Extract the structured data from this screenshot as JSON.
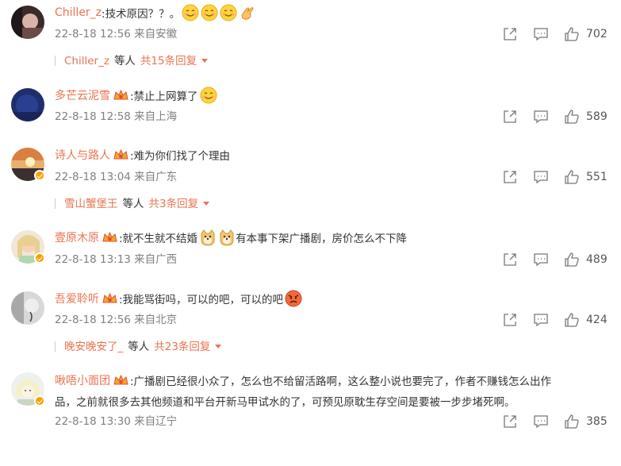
{
  "comments": [
    {
      "username": "Chiller_z",
      "text": ":技术原因？？。",
      "time": "22-8-18 12:56 来自安徽",
      "likes": "702",
      "emoji_icons": [
        "smile-emoji-icon",
        "smile-emoji-icon",
        "smile-emoji-icon",
        "clap-hand-icon"
      ],
      "replies": {
        "name": "Chiller_z",
        "etc": "等人",
        "count": "共15条回复"
      }
    },
    {
      "username": "多芒云泥雪",
      "text": ":禁止上网算了",
      "time": "22-8-18 12:58 来自上海",
      "likes": "589",
      "emoji_icons": [
        "smile-emoji-icon"
      ]
    },
    {
      "username": "诗人与路人",
      "text": ":难为你们找了个理由",
      "time": "22-8-18 13:04 来自广东",
      "likes": "551",
      "replies": {
        "name": "雪山蟹堡王",
        "etc": "等人",
        "count": "共3条回复"
      }
    },
    {
      "username": "壹原木原",
      "text_before": ":就不生就不结婚",
      "text_after": "有本事下架广播剧，房价怎么不下降",
      "time": "22-8-18 13:13 来自广西",
      "likes": "489",
      "emoji_icons": [
        "doge-emoji-icon",
        "doge-emoji-icon"
      ]
    },
    {
      "username": "吾爱聆听",
      "text": ":我能骂街吗，可以的吧，可以的吧",
      "time": "22-8-18 12:56 来自北京",
      "likes": "424",
      "emoji_icons": [
        "angry-emoji-icon"
      ],
      "replies": {
        "name": "晚安晚安了_",
        "etc": "等人",
        "count": "共23条回复"
      }
    },
    {
      "username": "啾唔小面团",
      "text": ":广播剧已经很小众了，怎么也不给留活路啊，这么整小说也要完了，作者不赚钱怎么出作",
      "text_line2": "品，之前就很多去其他频道和平台开新马甲试水的了，可预见原耽生存空间是要被一步步堵死啊。",
      "time": "22-8-18 13:30 来自辽宁",
      "likes": "385"
    }
  ],
  "colors": {
    "accent": "#eb7350",
    "meta": "#808080",
    "text": "#333333"
  }
}
